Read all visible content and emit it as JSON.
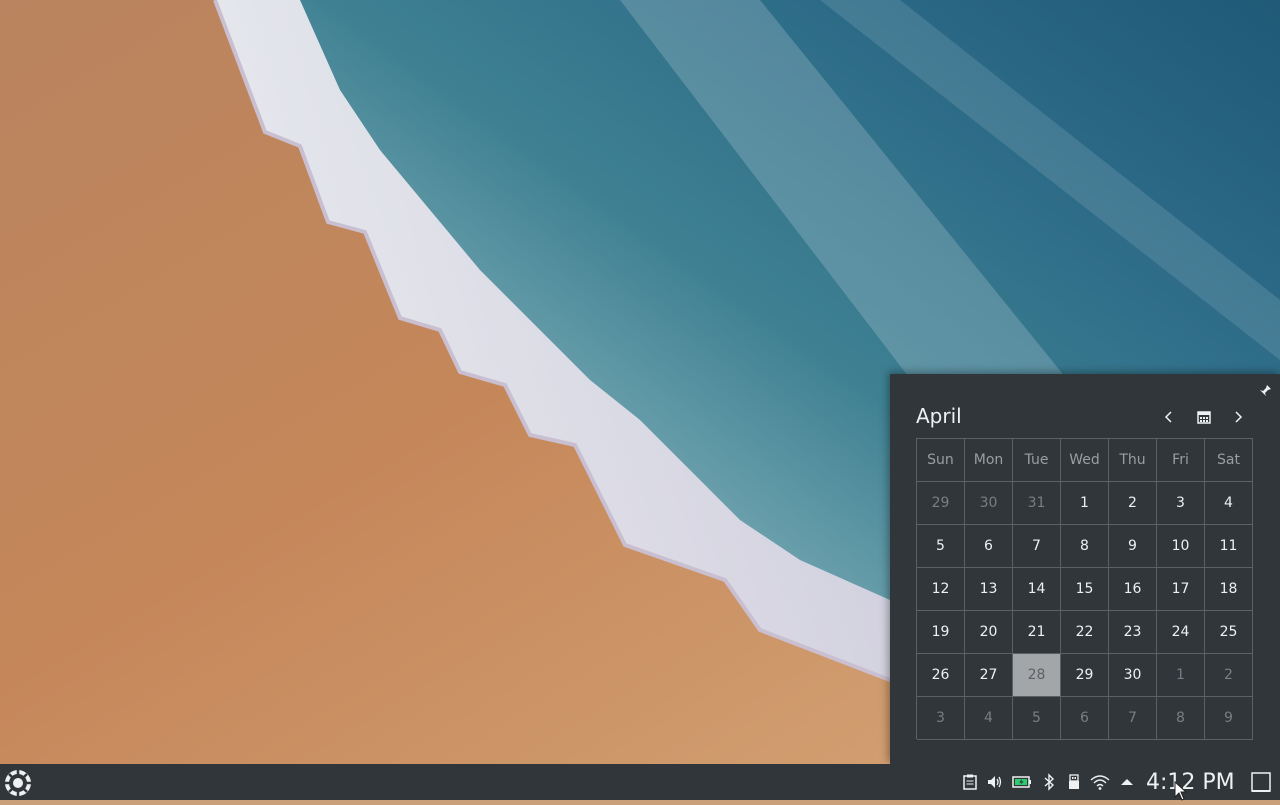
{
  "colors": {
    "panel_bg": "#31363b",
    "text": "#eff0f1",
    "muted_text": "#7a7e82",
    "header_text": "#9a9ea2",
    "today_bg": "#a3a6a9",
    "grid_line": "#5c6166",
    "sand": "#c68c5c",
    "sea": "#2e6f86",
    "foam": "#ece8ef"
  },
  "calendar": {
    "month": "April",
    "pin_icon": "pin-icon",
    "prev_icon": "chevron-left-icon",
    "today_icon": "calendar-icon",
    "next_icon": "chevron-right-icon",
    "weekdays": [
      "Sun",
      "Mon",
      "Tue",
      "Wed",
      "Thu",
      "Fri",
      "Sat"
    ],
    "weeks": [
      [
        {
          "d": "29",
          "m": true
        },
        {
          "d": "30",
          "m": true
        },
        {
          "d": "31",
          "m": true
        },
        {
          "d": "1"
        },
        {
          "d": "2"
        },
        {
          "d": "3"
        },
        {
          "d": "4"
        }
      ],
      [
        {
          "d": "5"
        },
        {
          "d": "6"
        },
        {
          "d": "7"
        },
        {
          "d": "8"
        },
        {
          "d": "9"
        },
        {
          "d": "10"
        },
        {
          "d": "11"
        }
      ],
      [
        {
          "d": "12"
        },
        {
          "d": "13"
        },
        {
          "d": "14"
        },
        {
          "d": "15"
        },
        {
          "d": "16"
        },
        {
          "d": "17"
        },
        {
          "d": "18"
        }
      ],
      [
        {
          "d": "19"
        },
        {
          "d": "20"
        },
        {
          "d": "21"
        },
        {
          "d": "22"
        },
        {
          "d": "23"
        },
        {
          "d": "24"
        },
        {
          "d": "25"
        }
      ],
      [
        {
          "d": "26"
        },
        {
          "d": "27"
        },
        {
          "d": "28",
          "today": true
        },
        {
          "d": "29"
        },
        {
          "d": "30"
        },
        {
          "d": "1",
          "m": true
        },
        {
          "d": "2",
          "m": true
        }
      ],
      [
        {
          "d": "3",
          "m": true
        },
        {
          "d": "4",
          "m": true
        },
        {
          "d": "5",
          "m": true
        },
        {
          "d": "6",
          "m": true
        },
        {
          "d": "7",
          "m": true
        },
        {
          "d": "8",
          "m": true
        },
        {
          "d": "9",
          "m": true
        }
      ]
    ]
  },
  "taskbar": {
    "launcher_icon": "application-launcher-icon",
    "tray": [
      {
        "name": "clipboard-icon"
      },
      {
        "name": "volume-icon"
      },
      {
        "name": "battery-icon"
      },
      {
        "name": "bluetooth-icon"
      },
      {
        "name": "usb-device-icon"
      },
      {
        "name": "wifi-icon"
      },
      {
        "name": "expand-tray-arrow-icon"
      }
    ],
    "clock": "4:12 PM",
    "show_desktop_icon": "show-desktop-icon"
  }
}
